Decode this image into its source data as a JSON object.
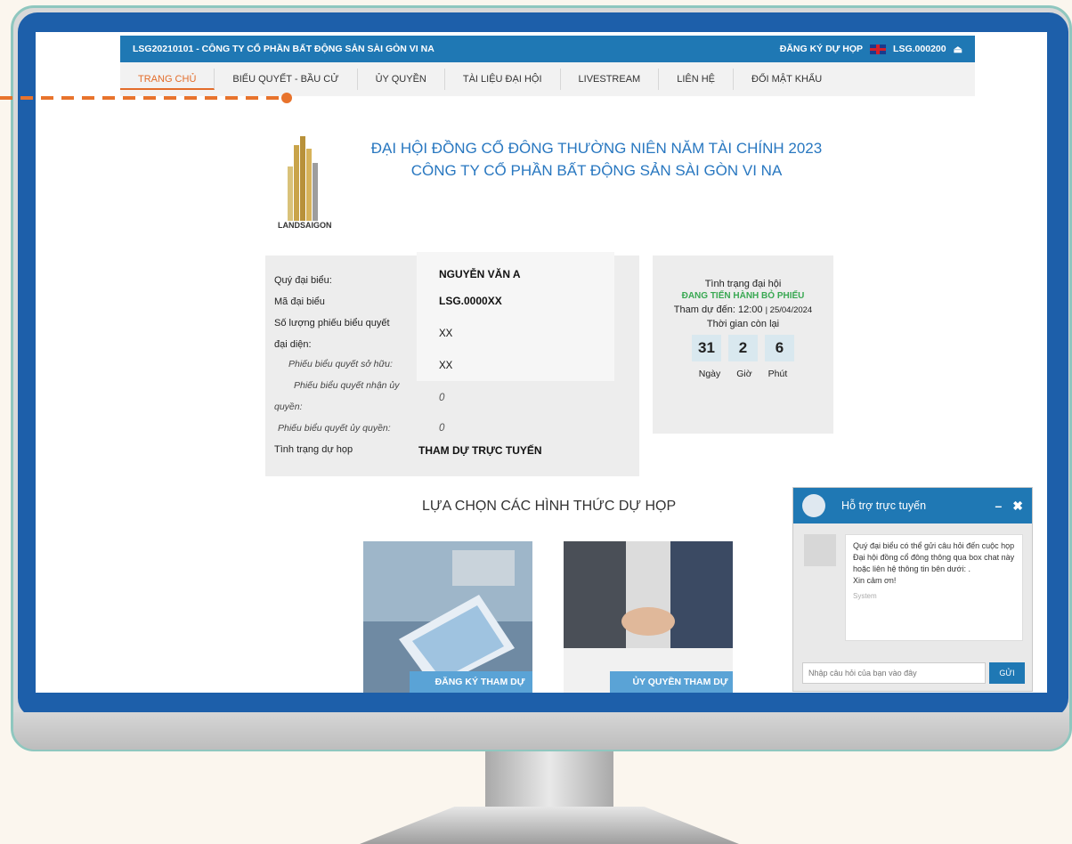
{
  "topbar": {
    "title": "LSG20210101 - CÔNG TY CỔ PHẦN BẤT ĐỘNG SẢN SÀI GÒN VI NA",
    "register": "ĐĂNG KÝ DỰ HỌP",
    "user": "LSG.000200"
  },
  "nav": [
    "TRANG CHỦ",
    "BIỂU QUYẾT - BẦU CỬ",
    "ỦY QUYỀN",
    "TÀI LIỆU ĐẠI HỘI",
    "LIVESTREAM",
    "LIÊN HỆ",
    "ĐỔI MẬT KHẨU"
  ],
  "logo_text": "LANDSAIGON",
  "headline": {
    "line1": "ĐẠI HỘI ĐỒNG CỔ ĐÔNG THƯỜNG NIÊN NĂM TÀI CHÍNH 2023",
    "line2": "CÔNG TY CỔ PHẦN BẤT ĐỘNG SẢN SÀI GÒN VI NA"
  },
  "info": {
    "l_name": "Quý đại biểu:",
    "l_code": "Mã đại biểu",
    "l_votes": "Số lượng phiếu biểu quyết",
    "l_votes2": "đại diện:",
    "l_owned": "Phiếu biểu quyết sở hữu:",
    "l_received": "Phiếu biểu quyết nhận ủy",
    "l_received2": "quyền:",
    "l_delegated": "Phiếu biểu quyết ủy quyền:",
    "l_status": "Tình trạng dự họp",
    "name": "NGUYỄN VĂN A",
    "code": "LSG.0000XX",
    "votes": "XX",
    "owned": "XX",
    "received": "0",
    "delegated": "0",
    "status": "THAM DỰ TRỰC TUYẾN"
  },
  "meeting": {
    "title": "Tình trạng đại hội",
    "state": "ĐANG TIẾN HÀNH BỎ PHIẾU",
    "attend_label": "Tham dự đến:",
    "attend_time": "12:00",
    "attend_date": "25/04/2024",
    "remaining": "Thời gian còn lại",
    "days": "31",
    "hours": "2",
    "minutes": "6",
    "u_days": "Ngày",
    "u_hours": "Giờ",
    "u_minutes": "Phút"
  },
  "choice_title": "LỰA CHỌN CÁC HÌNH THỨC DỰ HỌP",
  "choice_buttons": [
    "ĐĂNG KÝ THAM DỰ",
    "ỦY QUYỀN THAM DỰ"
  ],
  "chat": {
    "title": "Hỗ trợ trực tuyến",
    "minimize": "–",
    "close": "✖",
    "message": "Quý đại biểu có thể gửi câu hỏi đến cuộc họp Đại hội đồng cổ đông thông qua box chat này hoặc liên hệ thông tin bên dưới: .",
    "thanks": "Xin cảm ơn!",
    "sender": "System",
    "placeholder": "Nhập câu hỏi của bạn vào đây",
    "send": "GỬI"
  },
  "colors": {
    "primary": "#1f78b4",
    "accent": "#e36d2b",
    "green": "#39a852",
    "frame": "#1d5faa"
  }
}
